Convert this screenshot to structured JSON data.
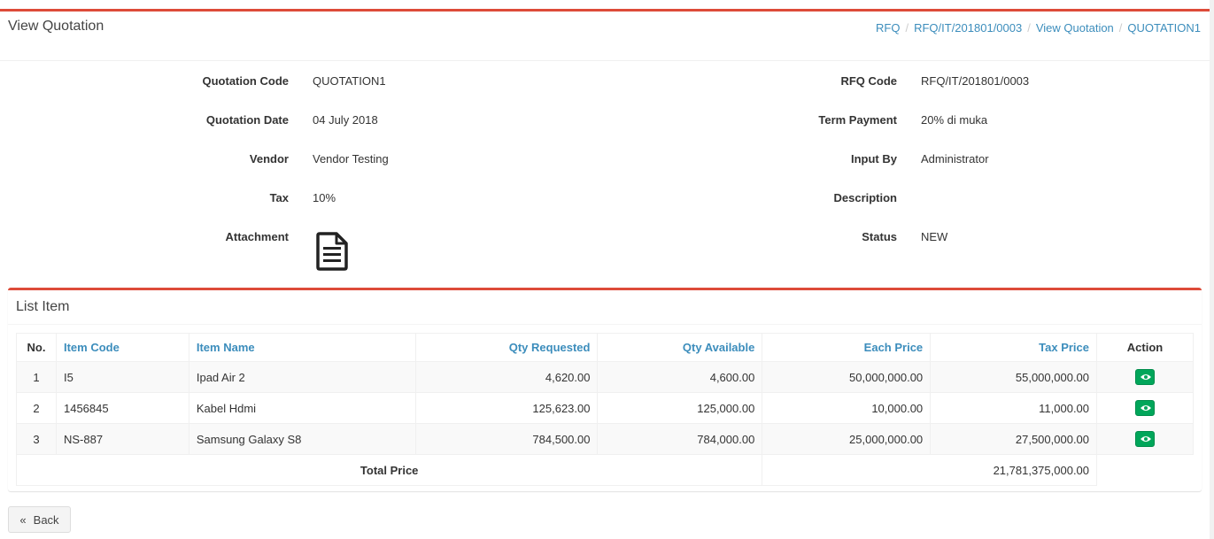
{
  "page": {
    "title": "View Quotation"
  },
  "breadcrumb": [
    "RFQ",
    "RFQ/IT/201801/0003",
    "View Quotation",
    "QUOTATION1"
  ],
  "details": {
    "quotation_code": {
      "label": "Quotation Code",
      "value": "QUOTATION1"
    },
    "quotation_date": {
      "label": "Quotation Date",
      "value": "04 July 2018"
    },
    "vendor": {
      "label": "Vendor",
      "value": "Vendor Testing"
    },
    "tax": {
      "label": "Tax",
      "value": "10%"
    },
    "attachment": {
      "label": "Attachment",
      "icon": "document-icon"
    },
    "rfq_code": {
      "label": "RFQ Code",
      "value": "RFQ/IT/201801/0003"
    },
    "term_payment": {
      "label": "Term Payment",
      "value": "20% di muka"
    },
    "input_by": {
      "label": "Input By",
      "value": "Administrator"
    },
    "description": {
      "label": "Description",
      "value": ""
    },
    "status": {
      "label": "Status",
      "value": "NEW"
    }
  },
  "list": {
    "title": "List Item",
    "columns": [
      "No.",
      "Item Code",
      "Item Name",
      "Qty Requested",
      "Qty Available",
      "Each Price",
      "Tax Price",
      "Action"
    ],
    "rows": [
      {
        "no": "1",
        "code": "I5",
        "name": "Ipad Air 2",
        "qty_req": "4,620.00",
        "qty_avail": "4,600.00",
        "each_price": "50,000,000.00",
        "tax_price": "55,000,000.00"
      },
      {
        "no": "2",
        "code": "1456845",
        "name": "Kabel Hdmi",
        "qty_req": "125,623.00",
        "qty_avail": "125,000.00",
        "each_price": "10,000.00",
        "tax_price": "11,000.00"
      },
      {
        "no": "3",
        "code": "NS-887",
        "name": "Samsung Galaxy S8",
        "qty_req": "784,500.00",
        "qty_avail": "784,000.00",
        "each_price": "25,000,000.00",
        "tax_price": "27,500,000.00"
      }
    ],
    "total_label": "Total Price",
    "total_value": "21,781,375,000.00",
    "action_icon": "eye-icon"
  },
  "back_button": {
    "label": "Back",
    "icon": "double-chevron-left-icon"
  },
  "colors": {
    "accent": "#dd4b39",
    "link": "#3c8dbc",
    "success": "#00a65a"
  }
}
